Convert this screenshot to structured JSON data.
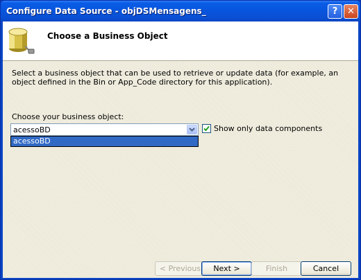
{
  "window": {
    "title": "Configure Data Source - objDSMensagens_",
    "help_label": "?",
    "close_label": "✕"
  },
  "header": {
    "title": "Choose a Business Object",
    "icon": "database-icon"
  },
  "body": {
    "description": "Select a business object that can be used to retrieve or update data (for example, an object defined in the Bin or App_Code directory for this application).",
    "choose_label": "Choose your business object:",
    "combo_value": "acessoBD",
    "dropdown_items": [
      "acessoBD"
    ],
    "show_only_label": "Show only data components",
    "show_only_checked": true
  },
  "footer": {
    "previous_label": "< Previous",
    "next_label": "Next >",
    "finish_label": "Finish",
    "cancel_label": "Cancel"
  },
  "colors": {
    "titlebar": "#0a5ce6",
    "selection": "#316ac5",
    "dialog_bg": "#ece9d8"
  }
}
